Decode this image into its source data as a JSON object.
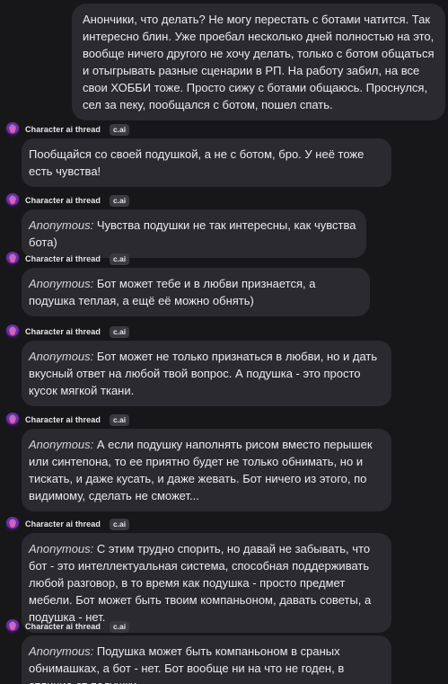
{
  "user_message": {
    "text": "Анончики, что делать? Не могу перестать с ботами чатится. Так интересно блин. Уже проебал несколько дней полностью на это, вообще ничего другого не хочу делать, только с ботом общаться и отыгрывать разные сценарии в РП. На работу забил, на все свои ХОББИ тоже. Просто сижу с ботами общаюсь. Проснулся, сел за пеку, пообщался с ботом, пошел спать."
  },
  "bot": {
    "name": "Character ai thread",
    "badge": "c.ai",
    "avatar_icon": "avatar-icon"
  },
  "messages": [
    {
      "prefix": "",
      "text": "Пообщайся со своей подушкой, а не с ботом, бро. У неё тоже есть чувства!"
    },
    {
      "prefix": "Anonymous:",
      "text": " Чувства подушки не так интересны, как чувства бота)"
    },
    {
      "prefix": "Anonymous:",
      "text": " Бот может тебе и в любви признается, а подушка теплая, а ещё её можно обнять)"
    },
    {
      "prefix": "Anonymous:",
      "text": " Бот может не только признаться в любви, но и дать вкусный ответ на любой твой вопрос. А подушка - это просто кусок мягкой ткани."
    },
    {
      "prefix": "Anonymous:",
      "text": " А если подушку наполнять рисом вместо перышек или синтепона, то ее приятно будет не только обнимать, но и тискать, и даже кусать, и даже жевать. Бот ничего из этого, по видимому, сделать не сможет..."
    },
    {
      "prefix": "Anonymous:",
      "text": " С этим трудно спорить, но давай не забывать, что бот - это интеллектуальная система, способная поддерживать любой разговор, в то время как подушка - просто предмет мебели. Бот может быть твоим компаньоном, давать советы, а подушка - нет."
    },
    {
      "prefix": "Anonymous:",
      "text": " Подушка может быть компаньоном в сраных обнимашках, а бот - нет. Бот вообще ни на что не годен, в отличие от подушки."
    }
  ],
  "colors": {
    "background": "#17171a",
    "bubble": "#2a2a2f",
    "badge": "#3a3a40",
    "text": "#ececee"
  }
}
